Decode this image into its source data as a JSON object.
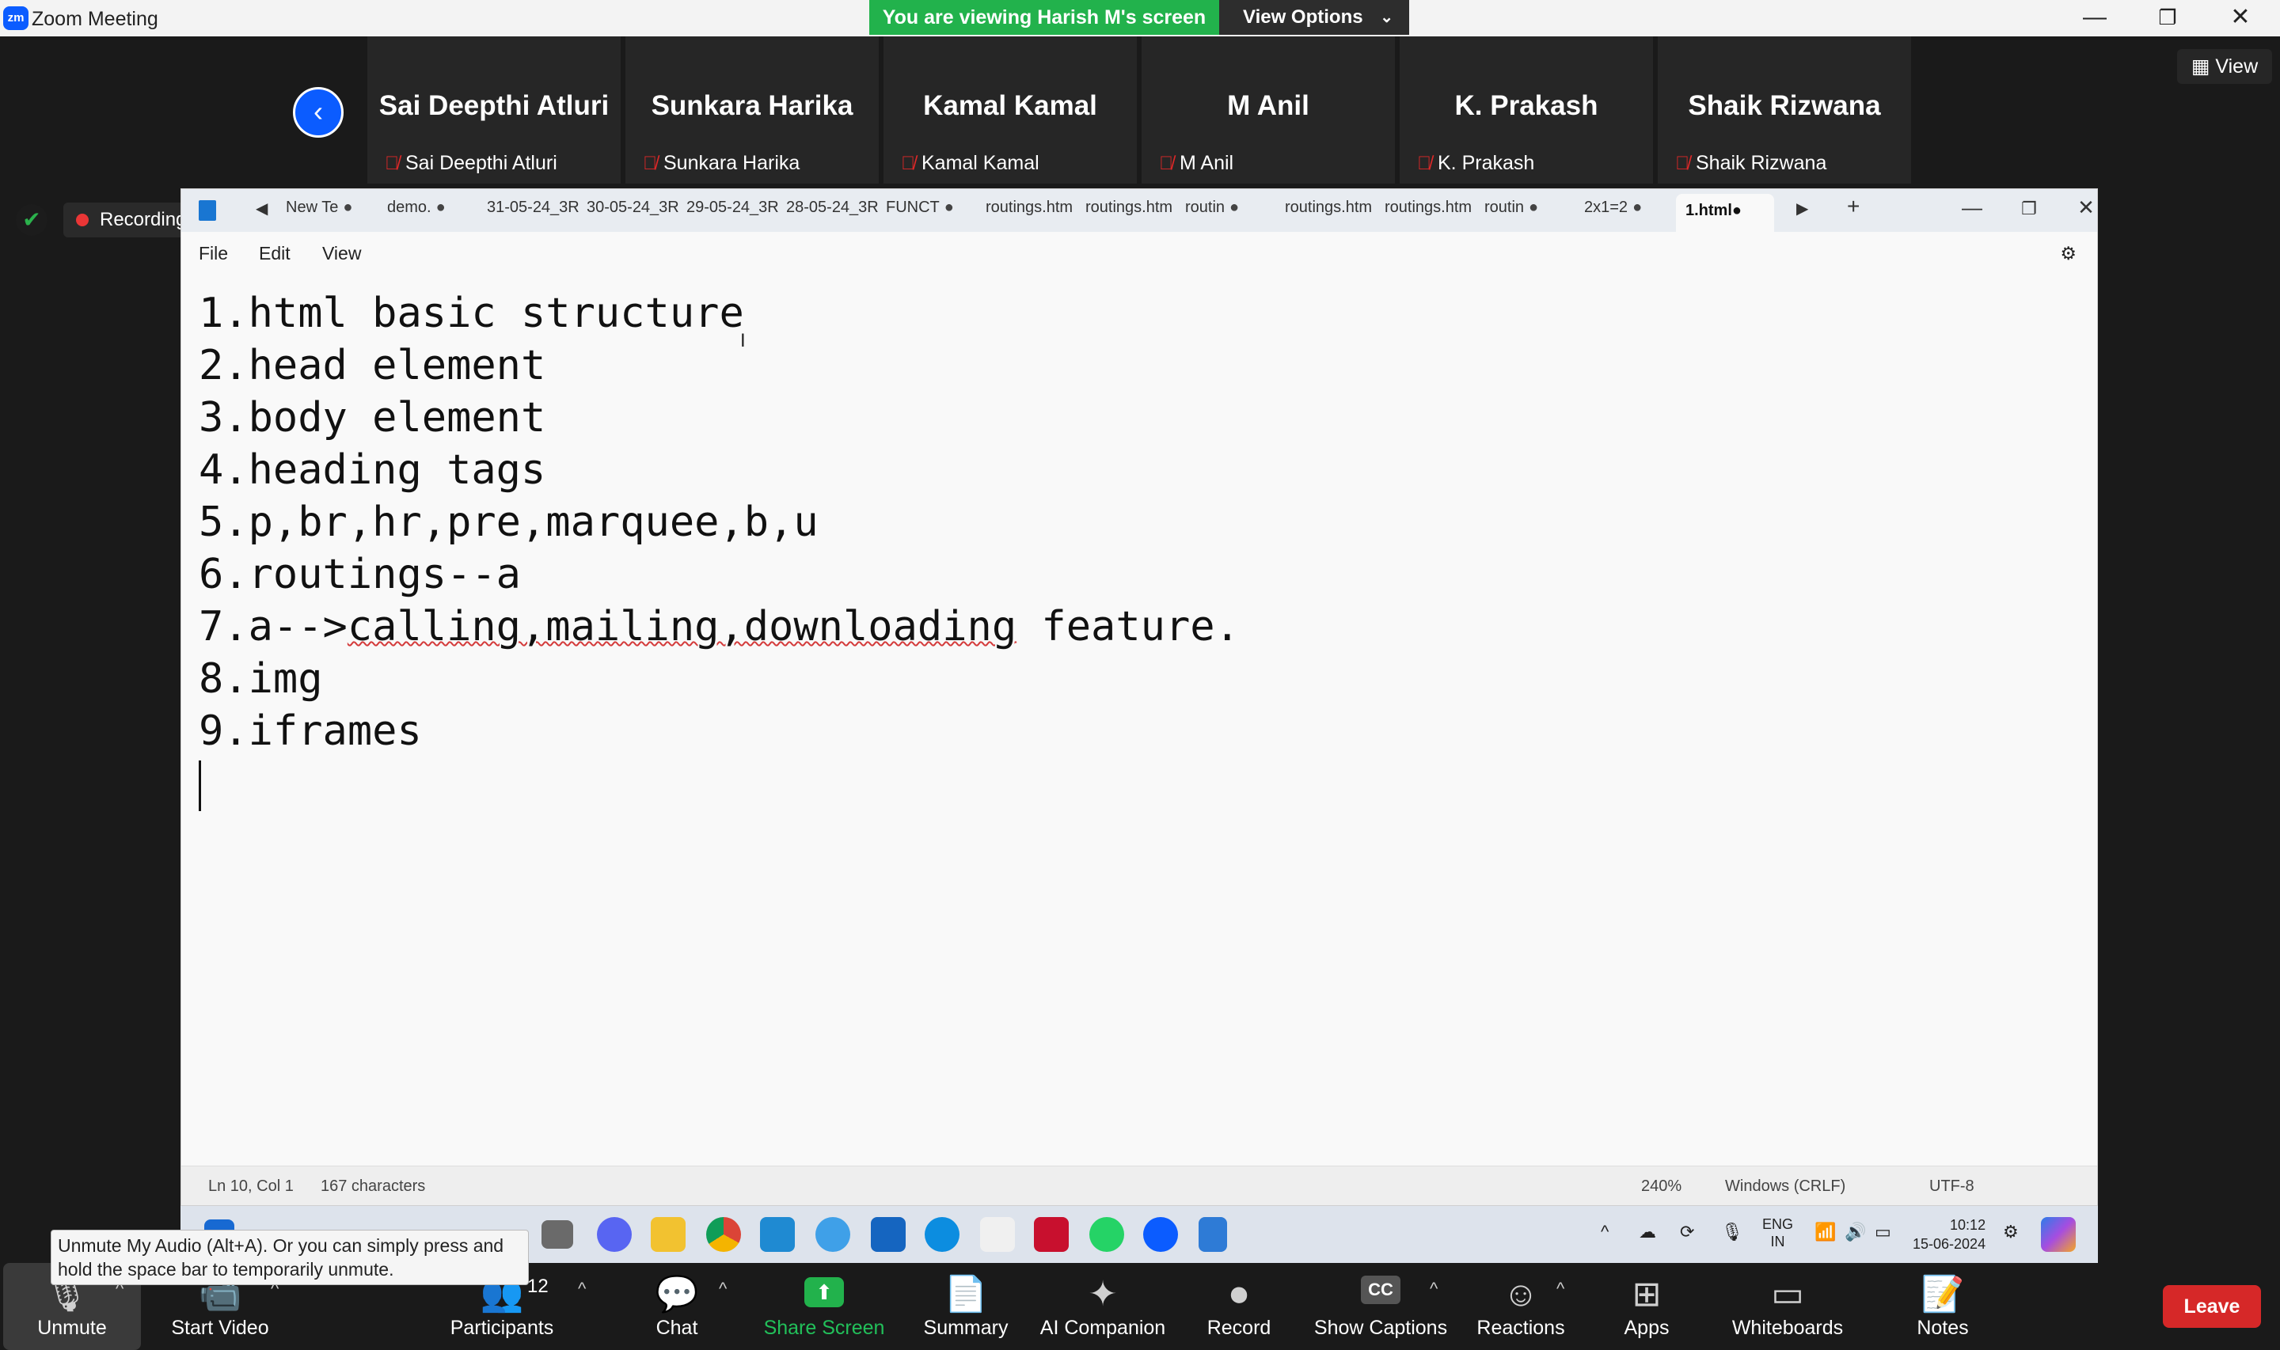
{
  "titlebar": {
    "logo": "zm",
    "title": "Zoom Meeting",
    "viewing_banner": "You are viewing Harish M's screen",
    "view_options": "View Options",
    "minimize": "—",
    "restore": "❐",
    "close": "✕"
  },
  "participants": [
    {
      "big": "Sai Deepthi Atluri",
      "small": "Sai Deepthi Atluri"
    },
    {
      "big": "Sunkara Harika",
      "small": "Sunkara Harika"
    },
    {
      "big": "Kamal Kamal",
      "small": "Kamal Kamal"
    },
    {
      "big": "M Anil",
      "small": "M Anil"
    },
    {
      "big": "K. Prakash",
      "small": "K. Prakash"
    },
    {
      "big": "Shaik Rizwana",
      "small": "Shaik Rizwana"
    }
  ],
  "strip": {
    "view_label": "View"
  },
  "recording": {
    "label": "Recording"
  },
  "notepad": {
    "tabs": [
      "New Te",
      "demo.",
      "31-05-24_3R",
      "30-05-24_3R",
      "29-05-24_3R",
      "28-05-24_3R",
      "FUNCT",
      "routings.htm",
      "routings.htm",
      "routin",
      "routings.htm",
      "routings.htm",
      "routin",
      "2x1=2"
    ],
    "active_tab": "1.html",
    "menu": {
      "file": "File",
      "edit": "Edit",
      "view": "View"
    },
    "lines": [
      "1.html basic structure",
      "2.head element",
      "3.body element",
      "4.heading tags",
      "5.p,br,hr,pre,marquee,b,u",
      "6.routings--a",
      "7.a-->",
      "8.img",
      "9.iframes"
    ],
    "line7_misspelled": "calling,mailing,downloading",
    "line7_rest": " feature.",
    "status": {
      "position": "Ln 10, Col 1",
      "chars": "167 characters",
      "zoom": "240%",
      "eol": "Windows (CRLF)",
      "encoding": "UTF-8"
    }
  },
  "taskbar": {
    "lang_top": "ENG",
    "lang_bottom": "IN",
    "time": "10:12",
    "date": "15-06-2024"
  },
  "tooltip": {
    "text": "Unmute My Audio (Alt+A). Or you can simply press and hold the space bar to temporarily unmute."
  },
  "controls": {
    "unmute": "Unmute",
    "start_video": "Start Video",
    "participants": "Participants",
    "participants_count": "12",
    "chat": "Chat",
    "share_screen": "Share Screen",
    "summary": "Summary",
    "ai_companion": "AI Companion",
    "record": "Record",
    "show_captions": "Show Captions",
    "captions_icon": "CC",
    "reactions": "Reactions",
    "apps": "Apps",
    "whiteboards": "Whiteboards",
    "notes": "Notes",
    "leave": "Leave"
  },
  "colors": {
    "banner_green": "#22b24c",
    "zoom_blue": "#0b5cff",
    "leave_red": "#d62828",
    "recording_red": "#ea3636"
  }
}
